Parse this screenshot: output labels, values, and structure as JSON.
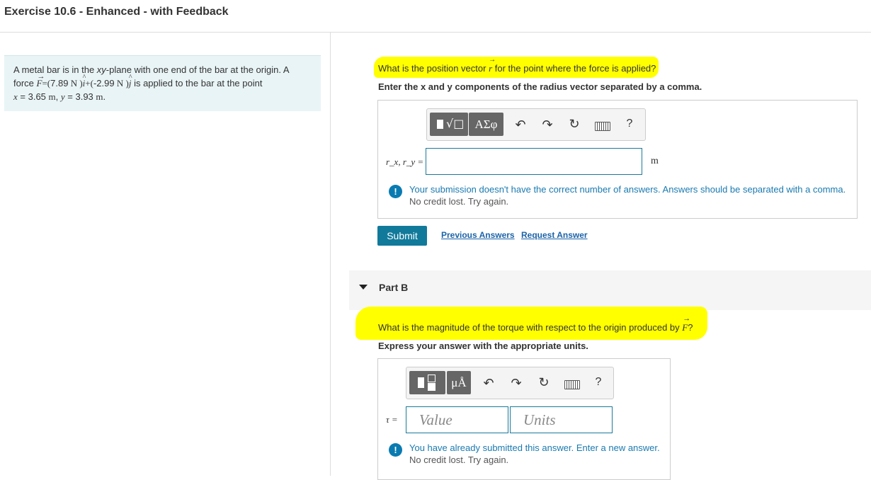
{
  "header": {
    "title": "Exercise 10.6 - Enhanced - with Feedback"
  },
  "problem": {
    "line1_a": "A metal bar is in the ",
    "line1_xy": "xy",
    "line1_b": "-plane with one end of the bar at the origin. A",
    "line2_a": "force ",
    "F_symbol": "F",
    "eq_open": "=(",
    "fx": "7.89",
    "unit_N1": " N )",
    "i_hat": "i",
    "plus": "+(",
    "fy": "-2.99",
    "unit_N2": " N )",
    "j_hat": "j",
    "line2_b": " is applied to the bar at the point",
    "x_var": "x",
    "x_val": " = 3.65 ",
    "x_unit": "m",
    "comma": ", ",
    "y_var": "y",
    "y_val": " = 3.93 ",
    "y_unit": "m",
    "period": "."
  },
  "partA": {
    "question_a": "What is the position vector ",
    "r_symbol": "r",
    "question_b": " for the point where the force is applied?",
    "instruction": "Enter the x and y components of the radius vector separated by a comma.",
    "toolbar": {
      "templates_icon": "fraction-sqrt-templates",
      "symbols_label": "ΑΣφ",
      "help_label": "?"
    },
    "input_label": "r_x, r_y =",
    "input_value": "",
    "unit": "m",
    "feedback_main": "Your submission doesn't have the correct number of answers. Answers should be separated with a comma.",
    "feedback_sub": "No credit lost. Try again.",
    "submit_label": "Submit",
    "previous_answers": "Previous Answers",
    "request_answer": "Request Answer"
  },
  "partB": {
    "title": "Part B",
    "question_a": "What is the magnitude of the torque with respect to the origin produced by ",
    "F_symbol": "F",
    "question_b": "?",
    "instruction": "Express your answer with the appropriate units.",
    "toolbar": {
      "templates_icon": "templates",
      "units_label": "μÅ",
      "help_label": "?"
    },
    "input_label": "τ =",
    "value_placeholder": "Value",
    "units_placeholder": "Units",
    "feedback_main": "You have already submitted this answer. Enter a new answer.",
    "feedback_sub": "No credit lost. Try again."
  },
  "colors": {
    "highlight": "#ffff00",
    "accent": "#117a9b",
    "link": "#1a63a8",
    "feedback": "#1a7ab0",
    "problem_bg": "#e9f4f6"
  }
}
